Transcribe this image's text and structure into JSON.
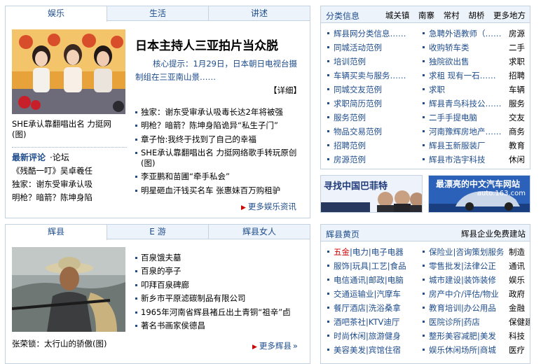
{
  "top_panel": {
    "tabs": [
      "娱乐",
      "生活",
      "讲述"
    ],
    "photo_caption": "SHE承认靠翻唱出名 力挺网(图)",
    "headline": "日本主持人三亚拍片当众脱",
    "summary_line1": "核心提示：1月29日，日本朝日电视台摄",
    "summary_line2": "制组在三亚南山景……",
    "detail_label": "【详细】",
    "news": [
      "独家：谢东受审承认吸毒长达2年将被强",
      "明枪？暗箭？陈坤身陷诡异“私生子门”",
      "章子怡:我终于找到了自己的幸福",
      "SHE承认靠翻唱出名 力挺网络歌手转玩原创(图)",
      "李亚鹏和苗圃“牵手私会”",
      "明星砸血汗钱买名车 张惠妹百万购租驴"
    ],
    "more_label": "更多娱乐资讯",
    "review": {
      "title": "最新评论",
      "forum": "论坛",
      "items": [
        "《残酷一叮》吴卓羲任",
        "独家：谢东受审承认吸",
        "明枪？暗箭？陈坤身陷"
      ]
    }
  },
  "bottom_panel": {
    "tabs": [
      "辉县",
      "E 游",
      "辉县女人"
    ],
    "photo_caption": "张荣锁：太行山的骄傲(图)",
    "news": [
      "百泉饿夫墓",
      "百泉的亭子",
      "叩拜百泉碑廊",
      "新乡市平原滤碳制品有限公司",
      "1965年河南省辉县褚丘出土青铜“祖辛”卣",
      "著名书画家侯德昌"
    ],
    "more_label": "更多辉县"
  },
  "classifieds": {
    "title": "分类信息",
    "links": [
      "城关镇",
      "南寨",
      "常村",
      "胡桥",
      "更多地方"
    ],
    "col1": [
      "辉县网分类信息……",
      "同城活动范例",
      "培训范例",
      "车辆买卖与服务……",
      "同城交友范例",
      "求职简历范例",
      "服务范例",
      "物品交易范例",
      "招聘范例",
      "房源范例"
    ],
    "col2": [
      "急聘外语教师（……",
      "收购轿车类",
      "独院欲出售",
      "求租 现有一石……",
      "求职",
      "辉县青鸟科技公……",
      "二手手提电脑",
      "河南豫辉房地产……",
      "辉县玉新服装厂",
      "辉县市浩宇科技"
    ],
    "side": [
      "房源",
      "二手",
      "求职",
      "招聘",
      "车辆",
      "服务",
      "交友",
      "商务",
      "教育",
      "休闲"
    ]
  },
  "ads": {
    "ad1_text": "寻找中国巴菲特",
    "ad2_text": "最漂亮的中文汽车网站",
    "ad2_url": "auto.163.com"
  },
  "yellow_pages": {
    "title": "辉县黄页",
    "right_link": "辉县企业免费建站",
    "col1": [
      [
        "五金",
        "电力",
        "电子电器"
      ],
      [
        "服饰",
        "玩具",
        "工艺",
        "食品"
      ],
      [
        "电信通讯",
        "邮政",
        "电脑"
      ],
      [
        "交通运输业",
        "汽摩车"
      ],
      [
        "餐厅酒店",
        "洗浴桑拿"
      ],
      [
        "酒吧茶社",
        "KTV迪厅"
      ],
      [
        "时尚休闲",
        "旅游健身"
      ],
      [
        "美容美发",
        "宾馆住宿"
      ]
    ],
    "col2": [
      [
        "保险业",
        "咨询策划服务"
      ],
      [
        "零售批发",
        "法律公正"
      ],
      [
        "城市建设",
        "装饰装修"
      ],
      [
        "房产中介/评估/物业"
      ],
      [
        "教育培训",
        "办公用品"
      ],
      [
        "医院诊所",
        "药店"
      ],
      [
        "整形美容减肥",
        "美发"
      ],
      [
        "娱乐休闲场所",
        "商城"
      ]
    ],
    "side": [
      "制造",
      "通讯",
      "娱乐",
      "政府",
      "金融",
      "保健建筑",
      "科技",
      "医疗"
    ]
  },
  "colors": {
    "accent": "#1f4d8c",
    "border": "#c4d2e2",
    "tab_bg": "#edf3fa",
    "highlight": "#cc0000"
  }
}
